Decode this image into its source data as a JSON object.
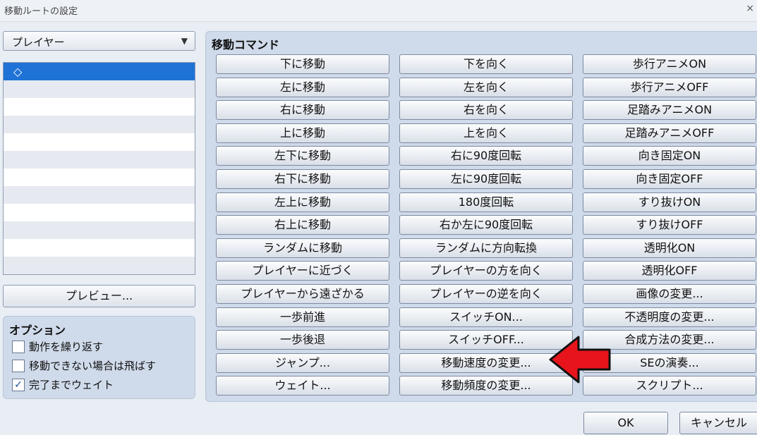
{
  "window": {
    "title": "移動ルートの設定",
    "close_glyph": "×"
  },
  "character_select": {
    "value": "プレイヤー",
    "arrow": "▼"
  },
  "route_list": {
    "rows": [
      "◇",
      "",
      "",
      "",
      "",
      "",
      "",
      "",
      "",
      "",
      "",
      ""
    ]
  },
  "preview_button": "プレビュー...",
  "options": {
    "title": "オプション",
    "items": [
      {
        "label": "動作を繰り返す",
        "checked": false
      },
      {
        "label": "移動できない場合は飛ばす",
        "checked": false
      },
      {
        "label": "完了までウェイト",
        "checked": true
      }
    ]
  },
  "move_commands": {
    "title": "移動コマンド",
    "columns": [
      [
        "下に移動",
        "左に移動",
        "右に移動",
        "上に移動",
        "左下に移動",
        "右下に移動",
        "左上に移動",
        "右上に移動",
        "ランダムに移動",
        "プレイヤーに近づく",
        "プレイヤーから遠ざかる",
        "一歩前進",
        "一歩後退",
        "ジャンプ...",
        "ウェイト..."
      ],
      [
        "下を向く",
        "左を向く",
        "右を向く",
        "上を向く",
        "右に90度回転",
        "左に90度回転",
        "180度回転",
        "右か左に90度回転",
        "ランダムに方向転換",
        "プレイヤーの方を向く",
        "プレイヤーの逆を向く",
        "スイッチON...",
        "スイッチOFF...",
        "移動速度の変更...",
        "移動頻度の変更..."
      ],
      [
        "歩行アニメON",
        "歩行アニメOFF",
        "足踏みアニメON",
        "足踏みアニメOFF",
        "向き固定ON",
        "向き固定OFF",
        "すり抜けON",
        "すり抜けOFF",
        "透明化ON",
        "透明化OFF",
        "画像の変更...",
        "不透明度の変更...",
        "合成方法の変更...",
        "SEの演奏...",
        "スクリプト..."
      ]
    ]
  },
  "buttons": {
    "ok": "OK",
    "cancel": "キャンセル"
  },
  "colors": {
    "highlight_arrow": "#e8141c",
    "selection": "#1f72d6",
    "panel": "#cfdaea"
  }
}
